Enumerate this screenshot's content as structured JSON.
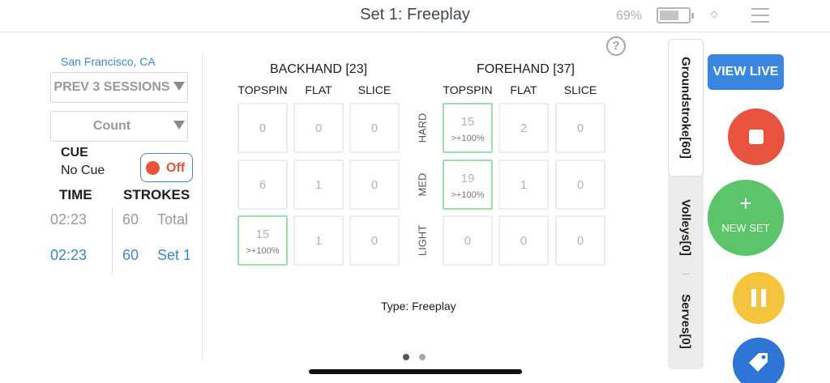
{
  "header": {
    "title": "Set 1: Freeplay",
    "battery_pct": "69%",
    "battery_level": 0.69
  },
  "left": {
    "location": "San Francisco, CA",
    "sessions_select": "PREV 3 SESSIONS",
    "count_select": "Count",
    "cue_label": "CUE",
    "cue_value": "No Cue",
    "toggle_label": "Off",
    "time_header": "TIME",
    "strokes_header": "STROKES",
    "rows": [
      {
        "time": "02:23",
        "strokes": "60",
        "label": "Total"
      },
      {
        "time": "02:23",
        "strokes": "60",
        "label": "Set 1"
      }
    ]
  },
  "grid": {
    "backhand_title": "BACKHAND [23]",
    "forehand_title": "FOREHAND [37]",
    "columns": [
      "TOPSPIN",
      "FLAT",
      "SLICE"
    ],
    "row_labels": [
      "HARD",
      "MED",
      "LIGHT"
    ],
    "backhand": [
      [
        {
          "v": "0"
        },
        {
          "v": "0"
        },
        {
          "v": "0"
        }
      ],
      [
        {
          "v": "6"
        },
        {
          "v": "1"
        },
        {
          "v": "0"
        }
      ],
      [
        {
          "v": "15",
          "s": ">+100%"
        },
        {
          "v": "1"
        },
        {
          "v": "0"
        }
      ]
    ],
    "forehand": [
      [
        {
          "v": "15",
          "s": ">+100%"
        },
        {
          "v": "2"
        },
        {
          "v": "0"
        }
      ],
      [
        {
          "v": "19",
          "s": ">+100%"
        },
        {
          "v": "1"
        },
        {
          "v": "0"
        }
      ],
      [
        {
          "v": "0"
        },
        {
          "v": "0"
        },
        {
          "v": "0"
        }
      ]
    ],
    "type_text": "Type: Freeplay"
  },
  "tabs": [
    "Groundstroke[60]",
    "Volleys[0]",
    "Serves[0]"
  ],
  "buttons": {
    "view_live": "VIEW LIVE",
    "new_set_plus": "+",
    "new_set": "NEW SET"
  },
  "help": "?",
  "colors": {
    "accent_blue": "#3a86e0",
    "stop_red": "#e8533f",
    "new_set_green": "#5cc56a",
    "pause_yellow": "#f5c63d",
    "tag_blue": "#2f75d6",
    "highlight_green": "#9be0a8"
  }
}
